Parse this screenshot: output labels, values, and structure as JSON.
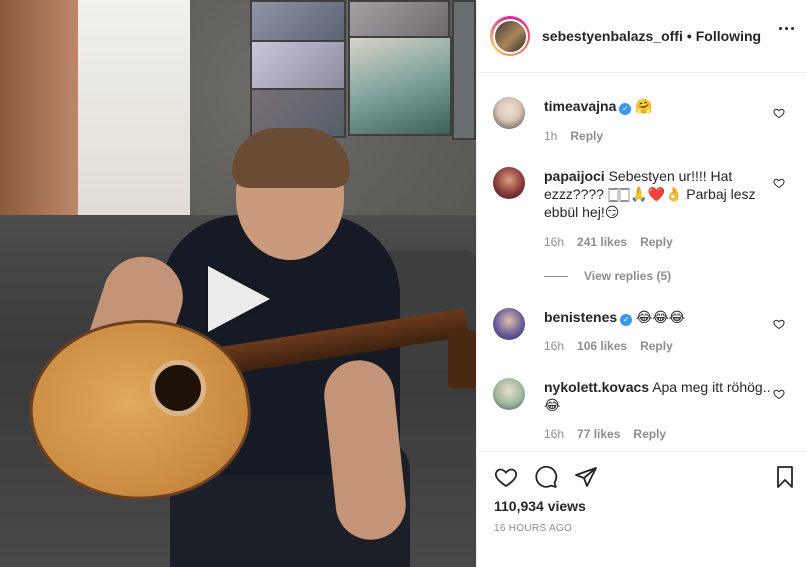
{
  "header": {
    "username": "sebestyenbalazs_offi",
    "separator": "•",
    "follow_label": "Following",
    "more_icon": "more-horizontal-icon"
  },
  "video": {
    "play_icon": "play-icon"
  },
  "comments": [
    {
      "username": "timeavajna",
      "verified": true,
      "text": "🤗",
      "time": "1h",
      "likes": "",
      "reply_label": "Reply",
      "avatar_color": "#d8c6b8"
    },
    {
      "username": "papaijoci",
      "verified": false,
      "text": "Sebestyen ur!!!! Hat ezzz???? 🀆🀆🙏❤️👌 Parbaj lesz ebbül hej!😏",
      "time": "16h",
      "likes": "241 likes",
      "reply_label": "Reply",
      "avatar_color": "#8a3a3a"
    },
    {
      "username": "benistenes",
      "verified": true,
      "text": "😂😂😂",
      "time": "16h",
      "likes": "106 likes",
      "reply_label": "Reply",
      "avatar_color": "#6a5f9a"
    },
    {
      "username": "nykolett.kovacs",
      "verified": false,
      "text": "Apa meg itt röhög.. 😂",
      "time": "16h",
      "likes": "77 likes",
      "reply_label": "Reply",
      "avatar_color": "#9fb7a0"
    }
  ],
  "view_replies_label": "View replies (5)",
  "actions": {
    "like_icon": "heart-icon",
    "comment_icon": "comment-icon",
    "share_icon": "share-icon",
    "save_icon": "bookmark-icon"
  },
  "stats": {
    "views": "110,934 views",
    "time_ago": "16 HOURS AGO"
  }
}
